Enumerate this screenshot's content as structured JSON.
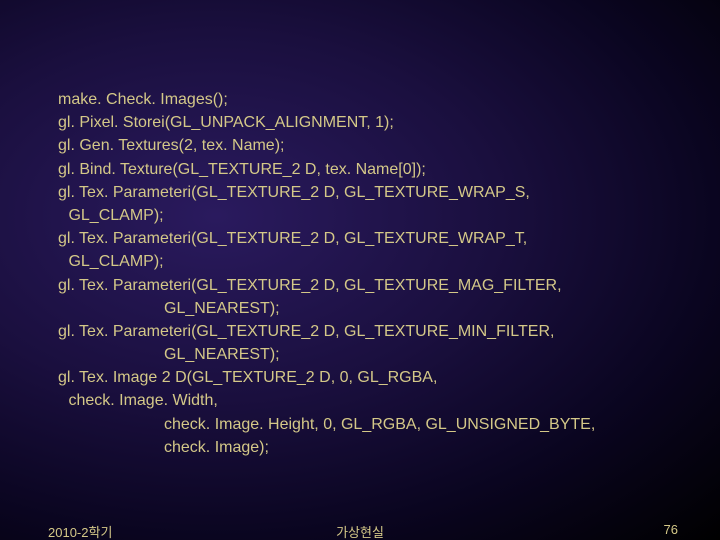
{
  "code": {
    "l1": "make. Check. Images();",
    "l2": "gl. Pixel. Storei(GL_UNPACK_ALIGNMENT, 1);",
    "l3": "gl. Gen. Textures(2, tex. Name);",
    "l4": "gl. Bind. Texture(GL_TEXTURE_2 D, tex. Name[0]);",
    "l5": "gl. Tex. Parameteri(GL_TEXTURE_2 D, GL_TEXTURE_WRAP_S,",
    "l6": " GL_CLAMP);",
    "l7": "gl. Tex. Parameteri(GL_TEXTURE_2 D, GL_TEXTURE_WRAP_T,",
    "l8": " GL_CLAMP);",
    "l9": "gl. Tex. Parameteri(GL_TEXTURE_2 D, GL_TEXTURE_MAG_FILTER,",
    "l10": "GL_NEAREST);",
    "l11": "gl. Tex. Parameteri(GL_TEXTURE_2 D, GL_TEXTURE_MIN_FILTER,",
    "l12": "GL_NEAREST);",
    "l13": "gl. Tex. Image 2 D(GL_TEXTURE_2 D, 0, GL_RGBA,",
    "l14": " check. Image. Width,",
    "l15": "check. Image. Height, 0, GL_RGBA, GL_UNSIGNED_BYTE,",
    "l16": "check. Image);"
  },
  "footer": {
    "left": "2010-2학기",
    "center": "가상현실",
    "right": "76"
  }
}
